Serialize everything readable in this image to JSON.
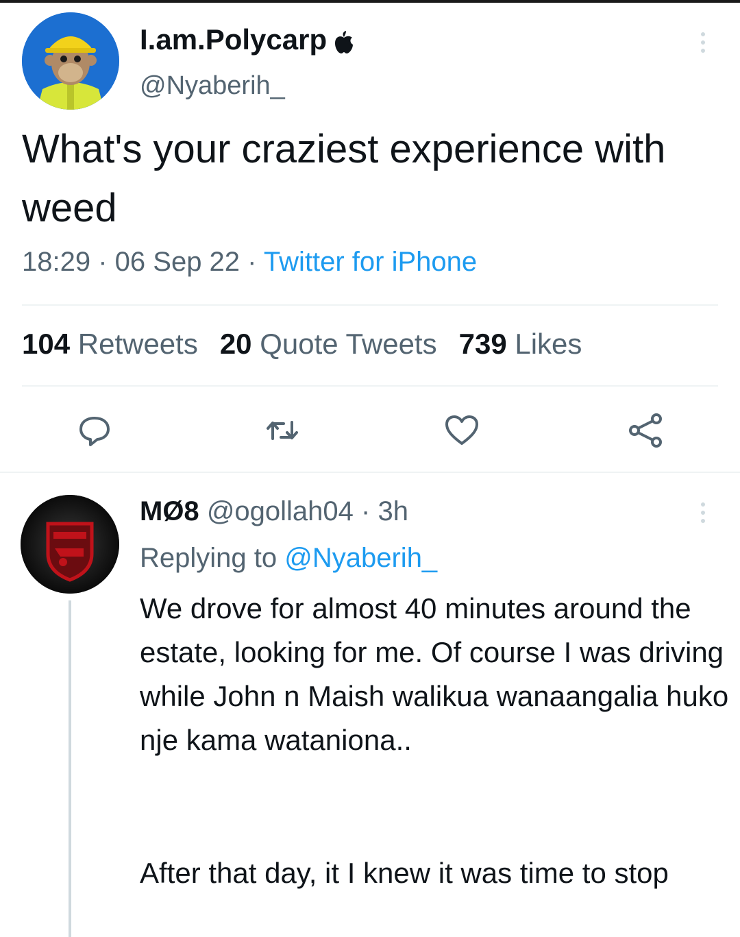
{
  "tweet": {
    "author_name": "I.am.Polycarp",
    "author_handle": "@Nyaberih_",
    "text": "What's your craziest experience with weed",
    "time": "18:29",
    "date": "06 Sep 22",
    "source": "Twitter for iPhone",
    "retweets_count": "104",
    "retweets_label": "Retweets",
    "quotes_count": "20",
    "quotes_label": "Quote Tweets",
    "likes_count": "739",
    "likes_label": "Likes"
  },
  "icons": {
    "author_badge": "apple-logo-icon",
    "more": "more-vertical-icon",
    "actions": [
      "reply-icon",
      "retweet-icon",
      "like-icon",
      "share-icon"
    ]
  },
  "reply": {
    "author_name": "MØ8",
    "author_handle": "@ogollah04",
    "age": "3h",
    "replying_prefix": "Replying to",
    "replying_to": "@Nyaberih_",
    "text_p1": "We drove for almost 40 minutes around the estate, looking for me. Of course I was driving while John n Maish walikua wanaangalia huko nje kama wataniona..",
    "text_p2": "After that day, it I knew it was time to stop"
  },
  "colors": {
    "accent": "#1d9bf0",
    "secondary_text": "#536471",
    "primary_text": "#0f1419",
    "divider": "#eff3f4"
  }
}
